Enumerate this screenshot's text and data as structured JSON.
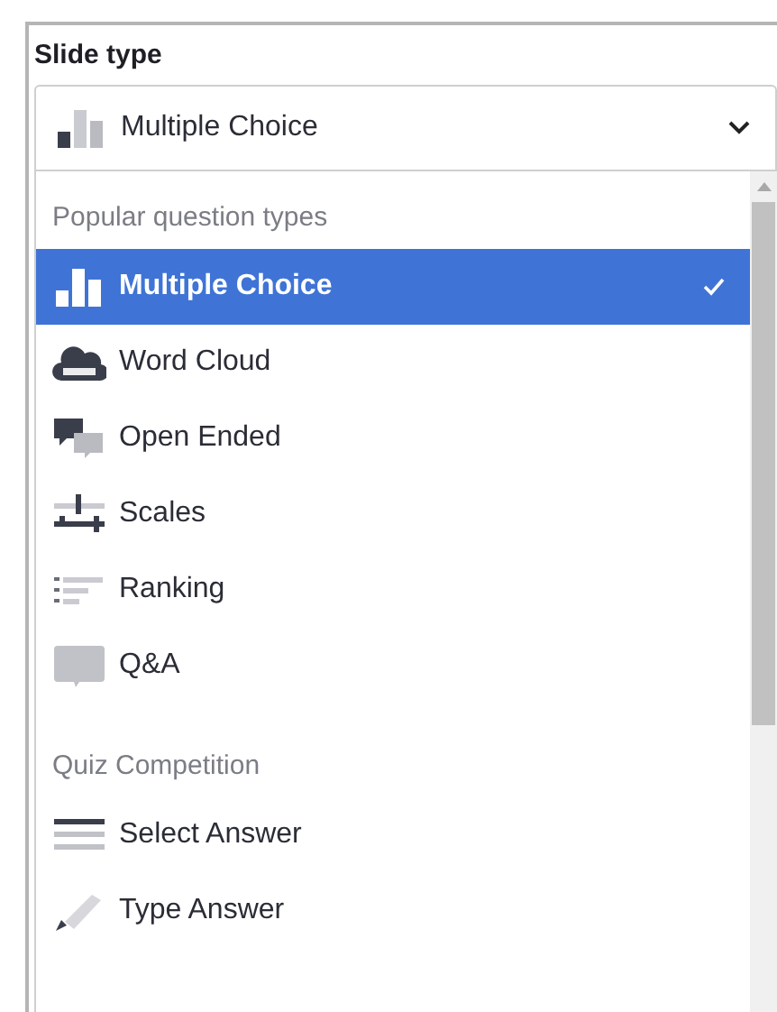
{
  "label": "Slide type",
  "select": {
    "value": "Multiple Choice",
    "kind": "bars"
  },
  "groups": [
    {
      "title": "Popular question types",
      "items": [
        {
          "label": "Multiple Choice",
          "kind": "bars",
          "selected": true
        },
        {
          "label": "Word Cloud",
          "kind": "cloud",
          "selected": false
        },
        {
          "label": "Open Ended",
          "kind": "bubbles",
          "selected": false
        },
        {
          "label": "Scales",
          "kind": "sliders",
          "selected": false
        },
        {
          "label": "Ranking",
          "kind": "ranking",
          "selected": false
        },
        {
          "label": "Q&A",
          "kind": "qa",
          "selected": false
        }
      ]
    },
    {
      "title": "Quiz Competition",
      "items": [
        {
          "label": "Select Answer",
          "kind": "lines",
          "selected": false
        },
        {
          "label": "Type Answer",
          "kind": "pencil",
          "selected": false
        }
      ]
    }
  ]
}
